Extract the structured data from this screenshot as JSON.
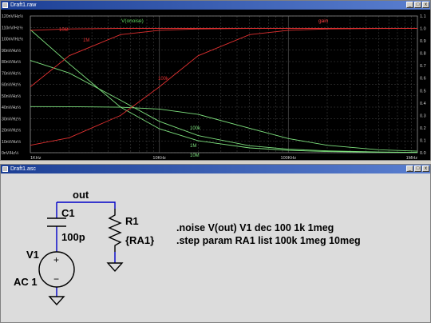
{
  "windows": {
    "plot_title": "Draft1.raw",
    "schematic_title": "Draft1.asc"
  },
  "controls": {
    "minimize": "_",
    "maximize": "□",
    "close": "x"
  },
  "colors": {
    "plot_bg": "#000000",
    "grid": "#4a4a4a",
    "axis_text": "#d0d0d0",
    "noise_curves": "#7de07d",
    "gain_curve": "#e03030",
    "title_green": "#5fd75f",
    "title_red": "#ff4040",
    "schematic_bg": "#dcdcdc",
    "wire": "#0000c8",
    "component_text": "#000000"
  },
  "plot": {
    "trace_noise": "V(onoise)",
    "trace_gain": "gain",
    "left_axis_ticks": [
      "120nV/Hz½",
      "110nV/Hz½",
      "100nV/Hz½",
      "90nV/Hz½",
      "80nV/Hz½",
      "70nV/Hz½",
      "60nV/Hz½",
      "50nV/Hz½",
      "40nV/Hz½",
      "30nV/Hz½",
      "20nV/Hz½",
      "10nV/Hz½",
      "0nV/Hz½"
    ],
    "right_axis_ticks": [
      "1.1",
      "1.0",
      "0.9",
      "0.8",
      "0.7",
      "0.6",
      "0.5",
      "0.4",
      "0.3",
      "0.2",
      "0.1",
      "0.0"
    ],
    "x_axis_ticks": [
      "1KHz",
      "10KHz",
      "100KHz",
      "1MHz"
    ],
    "curve_labels": {
      "noise_100k": "100k",
      "noise_1m": "1M",
      "noise_10m": "10M",
      "gain_10m": "10M",
      "gain_1m": "1M",
      "gain_100k": "100k"
    }
  },
  "chart_data": {
    "type": "line",
    "xscale": "log",
    "xlim": [
      1000,
      1000000
    ],
    "xlabel": "",
    "ylabel_left": "",
    "ylabel_right": "",
    "ylim_left": [
      0,
      120
    ],
    "ylim_right": [
      0,
      1.1
    ],
    "grid": true,
    "x": [
      1000,
      2000,
      5000,
      10000,
      20000,
      50000,
      100000,
      200000,
      500000,
      1000000
    ],
    "series": [
      {
        "name": "100k",
        "axis": "left",
        "color": "#7de07d",
        "values": [
          40.5,
          40.4,
          39.9,
          38.3,
          33.6,
          21.5,
          12.4,
          6.5,
          2.6,
          1.3
        ]
      },
      {
        "name": "1M",
        "axis": "left",
        "color": "#7de07d",
        "values": [
          81,
          70,
          46,
          27.5,
          15,
          6.1,
          3.1,
          1.6,
          0.6,
          0.3
        ]
      },
      {
        "name": "10M",
        "axis": "left",
        "color": "#7de07d",
        "values": [
          108,
          78,
          40,
          21,
          10.5,
          4.2,
          2.1,
          1.0,
          0.4,
          0.2
        ]
      },
      {
        "name": "100k",
        "axis": "right",
        "color": "#e03030",
        "values": [
          0.06,
          0.12,
          0.3,
          0.53,
          0.78,
          0.95,
          0.985,
          0.996,
          0.999,
          1.0
        ]
      },
      {
        "name": "1M",
        "axis": "right",
        "color": "#e03030",
        "values": [
          0.53,
          0.78,
          0.95,
          0.985,
          0.996,
          1.0,
          1.0,
          1.0,
          1.0,
          1.0
        ]
      },
      {
        "name": "10M",
        "axis": "right",
        "color": "#e03030",
        "values": [
          0.985,
          0.996,
          1.0,
          1.0,
          1.0,
          1.0,
          1.0,
          1.0,
          1.0,
          1.0
        ]
      }
    ]
  },
  "schematic": {
    "net_out": "out",
    "c1_name": "C1",
    "c1_value": "100p",
    "r1_name": "R1",
    "r1_value": "{RA1}",
    "v1_name": "V1",
    "v1_value": "AC 1",
    "plus": "+",
    "minus": "−",
    "directive_1": ".noise V(out) V1 dec 100 1k 1meg",
    "directive_2": ".step param RA1 list 100k 1meg 10meg"
  }
}
